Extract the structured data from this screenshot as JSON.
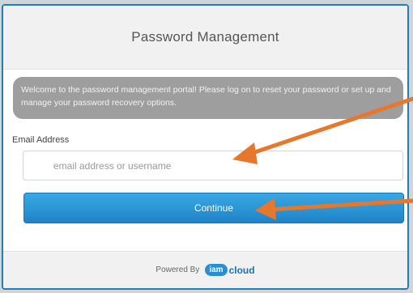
{
  "card": {
    "title": "Password Management",
    "welcome": "Welcome to the password management portal! Please log on to reset your password or set up and manage your password recovery options."
  },
  "form": {
    "email_label": "Email Address",
    "email_placeholder": "email address or username",
    "continue_label": "Continue"
  },
  "footer": {
    "powered_by": "Powered By",
    "logo_badge": "iam",
    "logo_text": "cloud"
  },
  "colors": {
    "accent": "#1f84c7",
    "annotation_arrow": "#e8772e"
  }
}
